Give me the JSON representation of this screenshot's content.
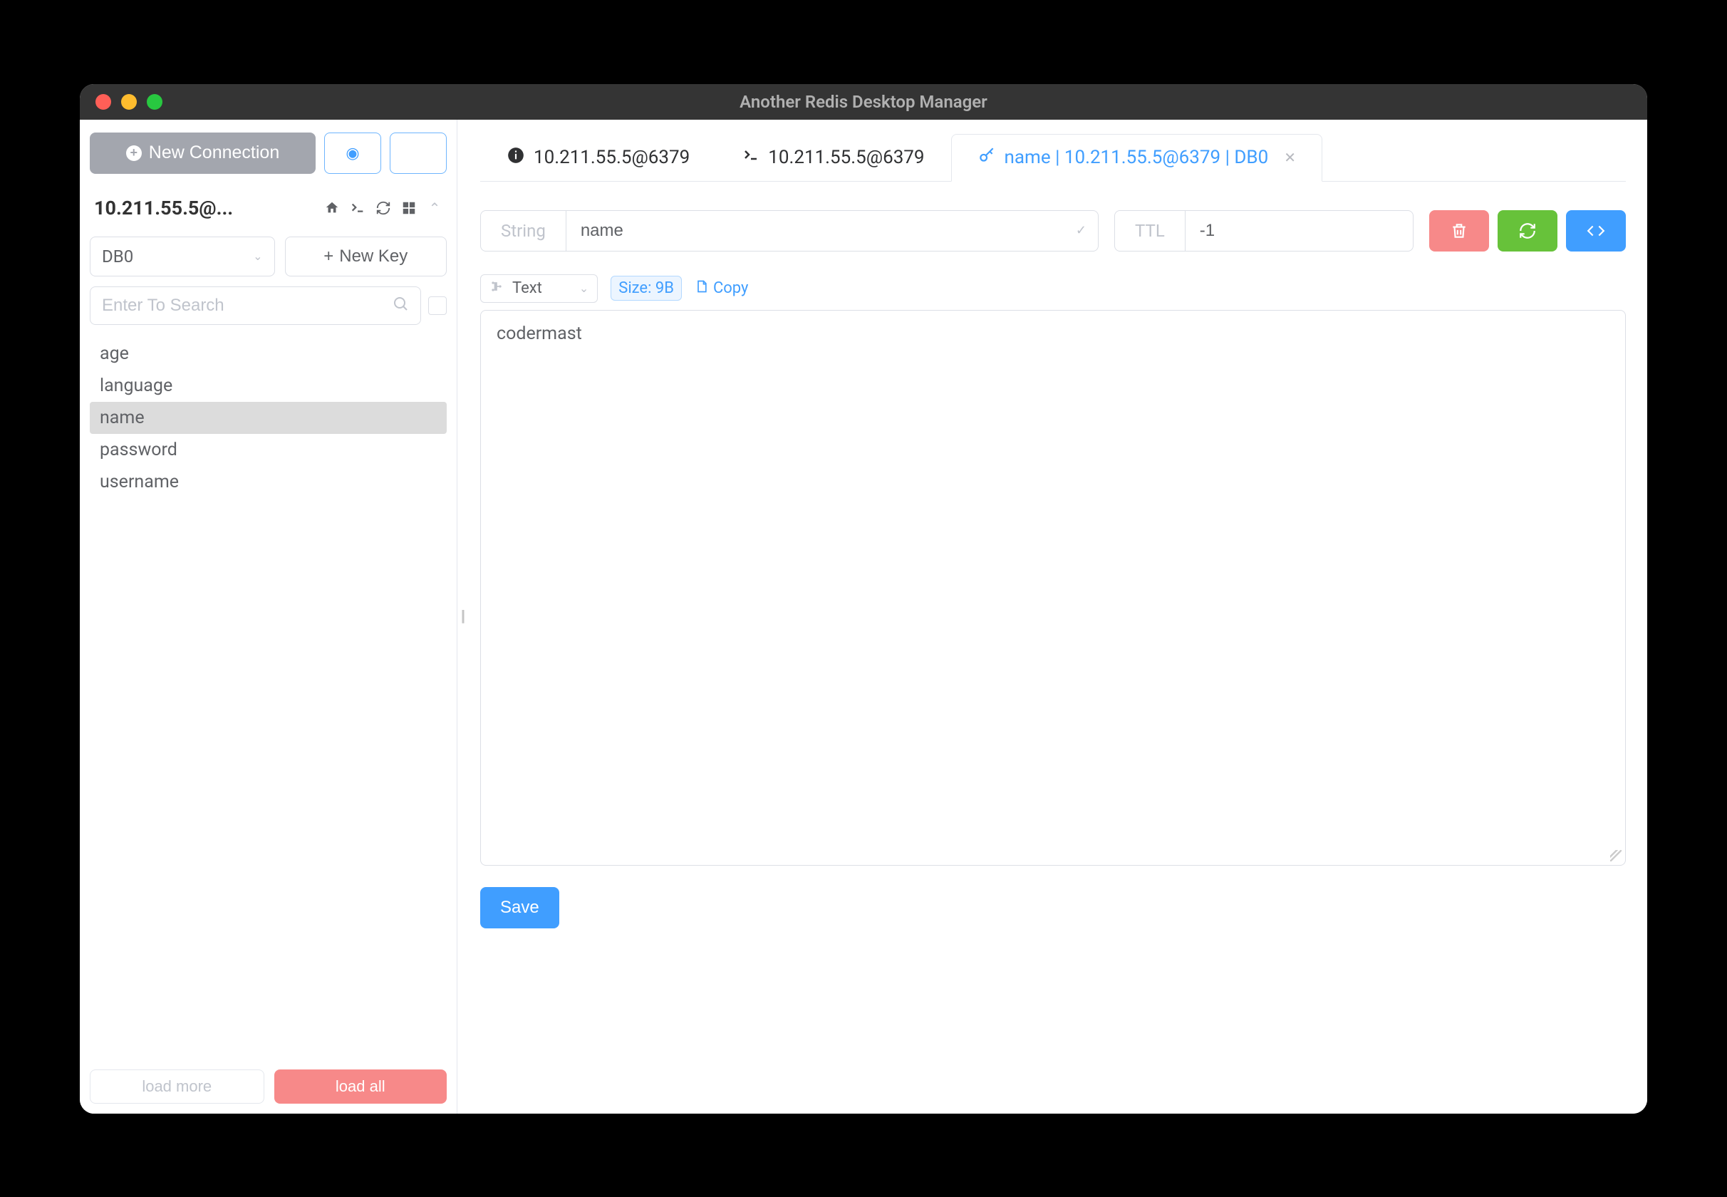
{
  "window": {
    "title": "Another Redis Desktop Manager"
  },
  "sidebar": {
    "newConnection": "New Connection",
    "connectionName": "10.211.55.5@...",
    "dbSelected": "DB0",
    "newKey": "New Key",
    "searchPlaceholder": "Enter To Search",
    "keys": [
      "age",
      "language",
      "name",
      "password",
      "username"
    ],
    "selectedKey": "name",
    "loadMore": "load more",
    "loadAll": "load all"
  },
  "tabs": [
    {
      "label": "10.211.55.5@6379",
      "icon": "info"
    },
    {
      "label": "10.211.55.5@6379",
      "icon": "terminal"
    },
    {
      "label": "name | 10.211.55.5@6379 | DB0",
      "icon": "key",
      "active": true
    }
  ],
  "detail": {
    "typeLabel": "String",
    "keyName": "name",
    "ttlLabel": "TTL",
    "ttlValue": "-1",
    "viewMode": "Text",
    "sizeText": "Size: 9B",
    "copyText": "Copy",
    "value": "codermast",
    "saveLabel": "Save"
  }
}
